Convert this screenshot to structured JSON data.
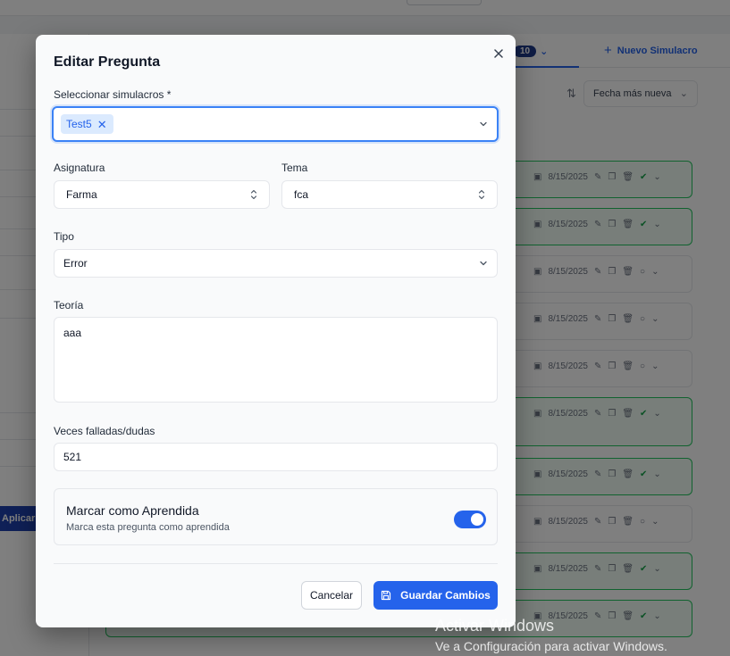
{
  "background": {
    "tab_count": "10",
    "new_simulacro_label": "Nuevo Simulacro",
    "order_label": "Fecha más nueva",
    "apply_filters_label": "Aplicar Filtros",
    "rows": [
      {
        "date": "8/15/2025",
        "learned": true
      },
      {
        "date": "8/15/2025",
        "learned": true
      },
      {
        "date": "8/15/2025",
        "learned": false
      },
      {
        "date": "8/15/2025",
        "learned": false
      },
      {
        "date": "8/15/2025",
        "learned": false
      },
      {
        "date": "8/15/2025",
        "learned": true
      },
      {
        "date": "8/15/2025",
        "learned": true
      },
      {
        "date": "8/15/2025",
        "learned": false
      },
      {
        "date": "8/15/2025",
        "learned": true
      },
      {
        "date": "8/15/2025",
        "learned": true
      }
    ]
  },
  "modal": {
    "title": "Editar Pregunta",
    "simulacros": {
      "label": "Seleccionar simulacros *",
      "selected_tags": [
        "Test5"
      ]
    },
    "asignatura": {
      "label": "Asignatura",
      "value": "Farma"
    },
    "tema": {
      "label": "Tema",
      "value": "fca"
    },
    "tipo": {
      "label": "Tipo",
      "value": "Error"
    },
    "teoria": {
      "label": "Teoría",
      "value": "aaa"
    },
    "veces": {
      "label": "Veces falladas/dudas",
      "value": "521"
    },
    "aprendida": {
      "title": "Marcar como Aprendida",
      "description": "Marca esta pregunta como aprendida",
      "checked": true
    },
    "buttons": {
      "cancel": "Cancelar",
      "save": "Guardar Cambios"
    }
  },
  "watermark": {
    "title": "Activar Windows",
    "subtitle": "Ve a Configuración para activar Windows."
  },
  "colors": {
    "primary": "#2563eb",
    "focus_border": "#3b82f6",
    "tag_bg": "#dbeafe",
    "learned_green": "#22c55e"
  }
}
